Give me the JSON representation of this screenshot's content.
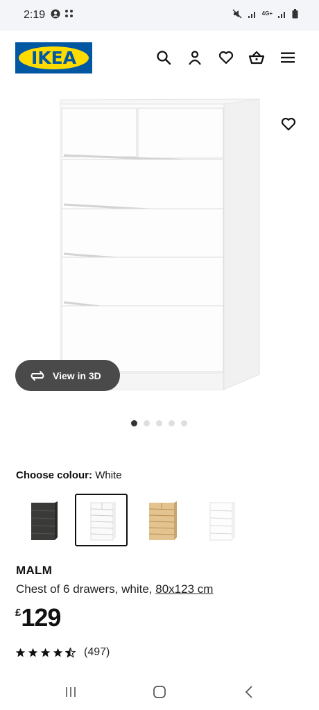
{
  "status_bar": {
    "time": "2:19",
    "network_label_top": "4G+",
    "icons": [
      "account-circle-icon",
      "grid-notification-icon",
      "mute-vibrate-icon",
      "signal-icon",
      "signal-icon",
      "battery-icon"
    ]
  },
  "header": {
    "logo_text": "IKEA",
    "icons": [
      "search-icon",
      "account-icon",
      "heart-icon",
      "basket-icon",
      "menu-icon"
    ]
  },
  "gallery": {
    "view_3d_label": "View in 3D",
    "dot_count": 5,
    "active_dot": 0
  },
  "colour": {
    "label": "Choose colour:",
    "value": "White",
    "options": [
      "black-brown",
      "white",
      "white stained oak veneer",
      "high-gloss white"
    ],
    "selected": 1
  },
  "product": {
    "name": "MALM",
    "description": "Chest of 6 drawers, white,",
    "size_link": "80x123 cm",
    "currency": "£",
    "price": "129",
    "rating_stars": 4.5,
    "review_count": "(497)"
  },
  "colors": {
    "brand_blue": "#0058a3",
    "brand_yellow": "#ffdb00",
    "pill_bg": "#4a4a4a"
  }
}
